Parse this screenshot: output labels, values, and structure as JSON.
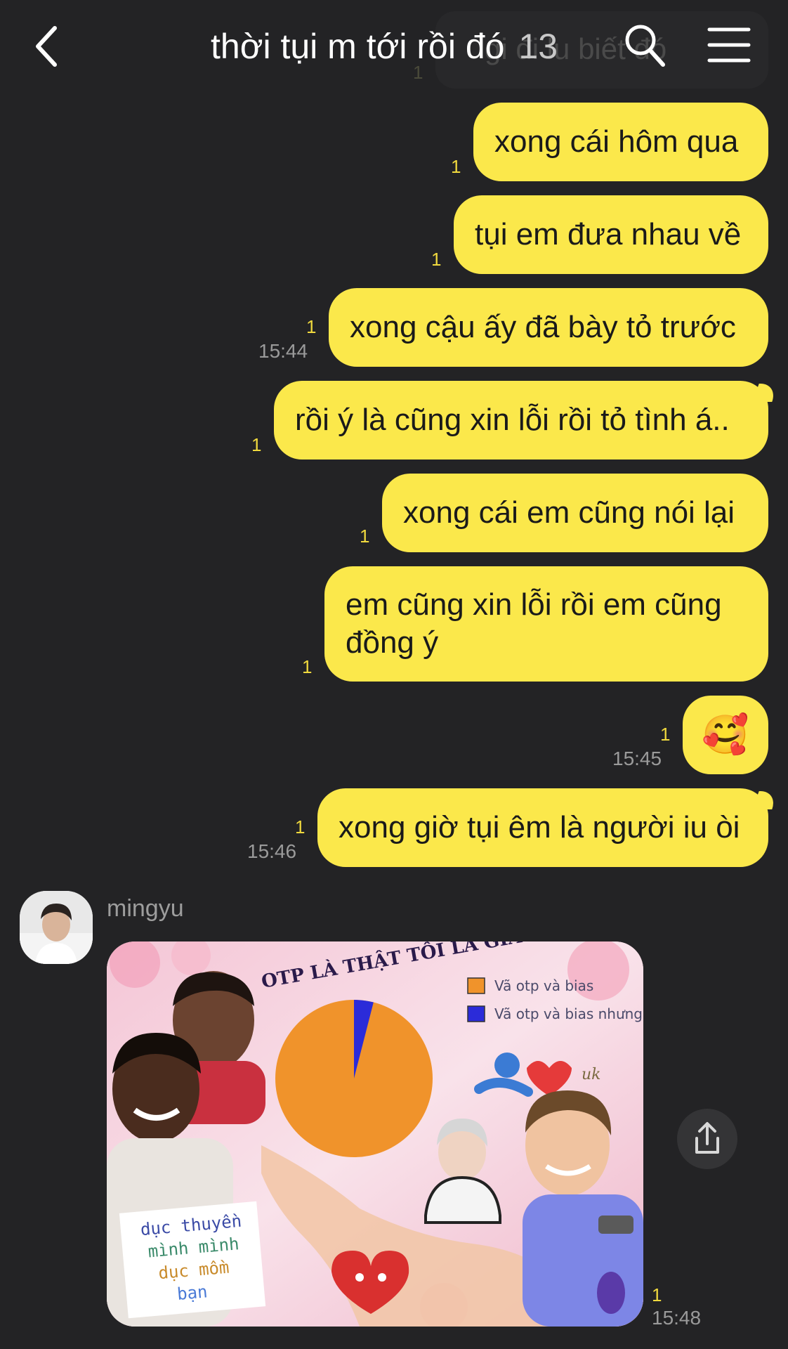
{
  "header": {
    "title": "thời tụi m tới rồi đó",
    "member_count": "13",
    "back_icon": "chevron-left-icon",
    "search_icon": "search-icon",
    "menu_icon": "hamburger-menu-icon"
  },
  "ghost_message": {
    "text": "gi đi lu biết đó",
    "read_count": "1"
  },
  "outgoing_messages": [
    {
      "text": "xong cái hôm qua",
      "read_count": "1",
      "time": ""
    },
    {
      "text": "tụi em đưa nhau về",
      "read_count": "1",
      "time": ""
    },
    {
      "text": "xong cậu ấy đã bày tỏ trước",
      "read_count": "1",
      "time": "15:44"
    },
    {
      "text": "rồi ý là cũng xin lỗi rồi tỏ tình á..",
      "read_count": "1",
      "time": ""
    },
    {
      "text": "xong cái em cũng nói lại",
      "read_count": "1",
      "time": ""
    },
    {
      "text": "em cũng xin lỗi rồi em cũng đồng ý",
      "read_count": "1",
      "time": ""
    },
    {
      "text": "🥰",
      "read_count": "1",
      "time": "15:45"
    },
    {
      "text": "xong giờ tụi êm là người iu òi",
      "read_count": "1",
      "time": "15:46"
    }
  ],
  "incoming": {
    "sender": "mingyu",
    "read_count": "1",
    "time": "15:48",
    "share_icon": "share-icon"
  },
  "meme": {
    "title": "OTP LÀ THẬT TÔI LÀ GIẢ",
    "legend": [
      {
        "label": "Vã otp và bias",
        "color": "#f0932b"
      },
      {
        "label": "Vã otp và bias nhưng màu xanh",
        "color": "#2b2bd9"
      }
    ],
    "sign_text": [
      "dục thuyền",
      "mình mình",
      "dục mồm",
      "bạn"
    ],
    "extra_text": "uk",
    "chart_data": {
      "type": "pie",
      "title": "OTP LÀ THẬT TÔI LÀ GIẢ",
      "categories": [
        "Vã otp và bias",
        "Vã otp và bias nhưng màu xanh"
      ],
      "values": [
        96,
        4
      ],
      "colors": [
        "#f0932b",
        "#2b2bd9"
      ],
      "legend": "top-right"
    }
  },
  "colors": {
    "background": "#232325",
    "bubble": "#fbe84b",
    "read_count": "#f0d93e",
    "time": "#9a9a9a"
  }
}
